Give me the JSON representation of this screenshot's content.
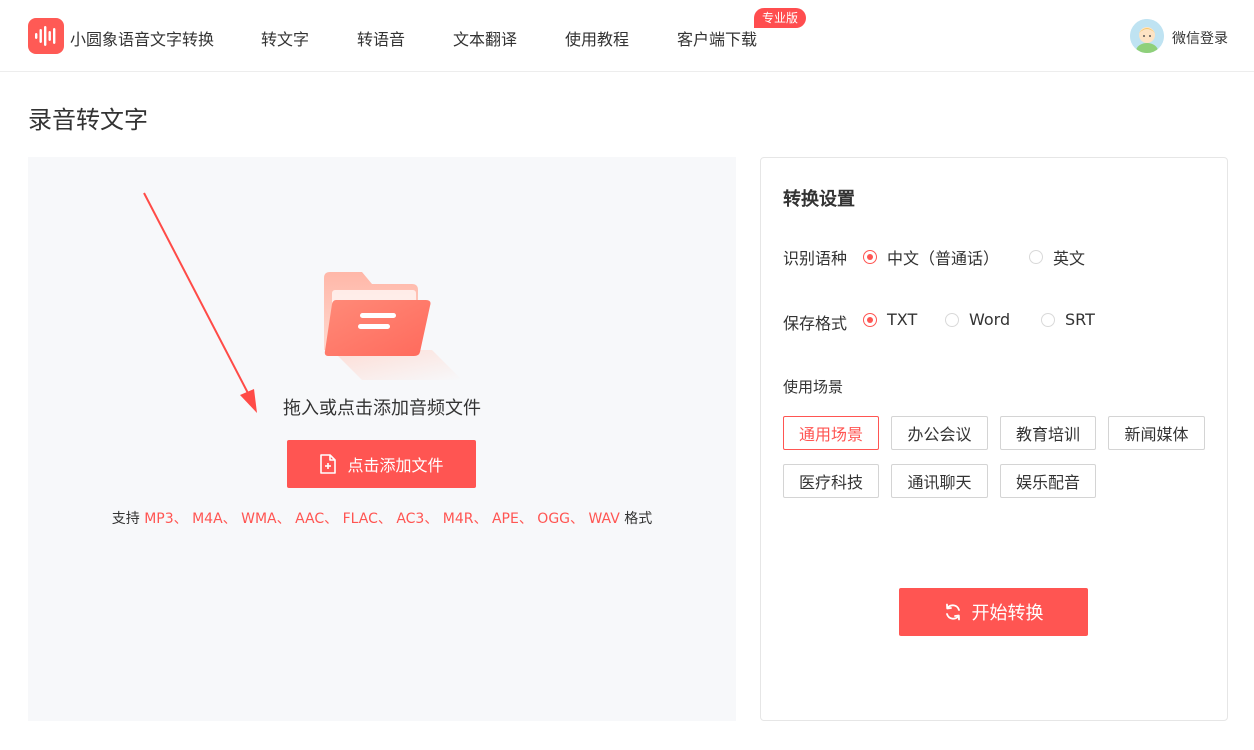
{
  "app": {
    "name": "小圆象语音文字转换"
  },
  "nav": {
    "items": [
      {
        "label": "转文字"
      },
      {
        "label": "转语音"
      },
      {
        "label": "文本翻译"
      },
      {
        "label": "使用教程"
      },
      {
        "label": "客户端下载"
      }
    ],
    "badge": "专业版",
    "login": "微信登录"
  },
  "page": {
    "title": "录音转文字"
  },
  "upload": {
    "drop_text": "拖入或点击添加音频文件",
    "button_label": "点击添加文件",
    "support_prefix": "支持",
    "formats": [
      "MP3",
      "M4A",
      "WMA",
      "AAC",
      "FLAC",
      "AC3",
      "M4R",
      "APE",
      "OGG",
      "WAV"
    ],
    "separator": "、",
    "support_suffix": "格式"
  },
  "settings": {
    "title": "转换设置",
    "language": {
      "label": "识别语种",
      "options": [
        {
          "label": "中文（普通话）",
          "selected": true
        },
        {
          "label": "英文",
          "selected": false
        }
      ]
    },
    "format": {
      "label": "保存格式",
      "options": [
        {
          "label": "TXT",
          "selected": true
        },
        {
          "label": "Word",
          "selected": false
        },
        {
          "label": "SRT",
          "selected": false
        }
      ]
    },
    "scene": {
      "label": "使用场景",
      "tags": [
        {
          "label": "通用场景",
          "active": true
        },
        {
          "label": "办公会议",
          "active": false
        },
        {
          "label": "教育培训",
          "active": false
        },
        {
          "label": "新闻媒体",
          "active": false
        },
        {
          "label": "医疗科技",
          "active": false
        },
        {
          "label": "通讯聊天",
          "active": false
        },
        {
          "label": "娱乐配音",
          "active": false
        }
      ]
    },
    "start_button": "开始转换"
  },
  "colors": {
    "accent": "#ff5552",
    "badge": "#ff4d4f",
    "upload_bg": "#f7f8fa"
  }
}
